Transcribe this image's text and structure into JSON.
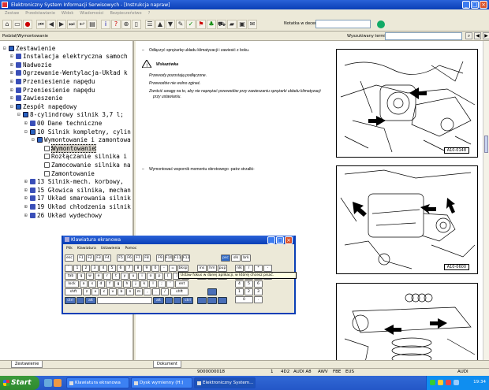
{
  "window": {
    "title": "Elektroniczny System Informacji Serwisowych - [Instrukcja napraw]"
  },
  "menu": [
    "Zestaw",
    "Przedstawianie",
    "Widok",
    "Wiadomości",
    "Bezpieczeństwo",
    "?"
  ],
  "toolbar": {
    "notes_label": "Notatka w decenie:"
  },
  "subbar": {
    "left_label": "Podział/Wymontowanie",
    "search_label": "Wyszukiwany termin"
  },
  "tree": {
    "items": [
      {
        "label": "Zestawienie",
        "level": 0,
        "exp": "⊟",
        "icon": "book"
      },
      {
        "label": "Instalacja elektryczna samoch",
        "level": 1,
        "exp": "⊞",
        "icon": "blue"
      },
      {
        "label": "Nadwozie",
        "level": 1,
        "exp": "⊞",
        "icon": "blue"
      },
      {
        "label": "Ogrzewanie-Wentylacja-Układ k",
        "level": 1,
        "exp": "⊞",
        "icon": "blue"
      },
      {
        "label": "Przeniesienie napędu",
        "level": 1,
        "exp": "⊞",
        "icon": "blue"
      },
      {
        "label": "Przeniesienie napędu",
        "level": 1,
        "exp": "⊞",
        "icon": "blue"
      },
      {
        "label": "Zawieszenie",
        "level": 1,
        "exp": "⊞",
        "icon": "blue"
      },
      {
        "label": "Zespół napędowy",
        "level": 1,
        "exp": "⊟",
        "icon": "book"
      },
      {
        "label": "8-cylindrowy silnik 3,7 l;",
        "level": 2,
        "exp": "⊟",
        "icon": "book"
      },
      {
        "label": "00 Dane techniczne",
        "level": 3,
        "exp": "⊞",
        "icon": "blue"
      },
      {
        "label": "10 Silnik kompletny, cylin",
        "level": 3,
        "exp": "⊟",
        "icon": "book"
      },
      {
        "label": "Wymontowanie i zamontowa",
        "level": 4,
        "exp": "⊟",
        "icon": "book"
      },
      {
        "label": "Wymontowanie",
        "level": 5,
        "exp": "",
        "icon": "doc",
        "selected": true
      },
      {
        "label": "Rozłączanie silnika i",
        "level": 5,
        "exp": "",
        "icon": "doc"
      },
      {
        "label": "Zamocowanie silnika na",
        "level": 5,
        "exp": "",
        "icon": "doc"
      },
      {
        "label": "Zamontowanie",
        "level": 5,
        "exp": "",
        "icon": "doc"
      },
      {
        "label": "13 Silnik-mech. korbowy,",
        "level": 3,
        "exp": "⊞",
        "icon": "blue"
      },
      {
        "label": "15 Głowica silnika, mechan",
        "level": 3,
        "exp": "⊞",
        "icon": "blue"
      },
      {
        "label": "17 Układ smarowania silnik",
        "level": 3,
        "exp": "⊞",
        "icon": "blue"
      },
      {
        "label": "19 Układ chłodzenia silnik",
        "level": 3,
        "exp": "⊞",
        "icon": "blue"
      },
      {
        "label": "26 Układ wydechowy",
        "level": 3,
        "exp": "⊞",
        "icon": "blue"
      }
    ],
    "tab_label": "Zestawienie"
  },
  "document": {
    "step1": "Odłączyć sprężarkę układu klimatyzacji i zawiesić z boku.",
    "note_title": "Wskazówka",
    "note_lines": [
      "Przewody pozostają podłączone.",
      "Przewodów nie wolno zginać.",
      "Zwrócić uwagę na to, aby nie naprężać przewodów przy zawieszaniu sprężarki układu klimatyzacji",
      "przy ustawianiu."
    ],
    "step2": "Wymontować wspornik momentu obrotowego -patrz strzałki-",
    "fig1_label": "A10-0148",
    "fig2_label": "A10-0600",
    "tab_label": "Dokument"
  },
  "statusbar": {
    "code": "9000000018",
    "num": "1",
    "model_code": "4D2",
    "brand": "AUDI A8",
    "drive": "AWV",
    "engine": "FBE",
    "market": "EUS",
    "right": "AUDI"
  },
  "osk": {
    "title": "Klawiatura ekranowa",
    "menu": [
      "Plik",
      "Klawiatura",
      "Ustawienia",
      "Pomoc"
    ],
    "tooltip": "Ustaw fokus w danej aplikacji, w której chcesz pisać.",
    "row_f": [
      "esc",
      "F1",
      "F2",
      "F3",
      "F4",
      "F5",
      "F6",
      "F7",
      "F8",
      "F9",
      "F10",
      "F11",
      "F12",
      "psc",
      "slk",
      "brk"
    ],
    "row_num": [
      "`",
      "1",
      "2",
      "3",
      "4",
      "5",
      "6",
      "7",
      "8",
      "9",
      "0",
      "-",
      "=",
      "bksp"
    ],
    "row_q": [
      "tab",
      "q",
      "w",
      "e",
      "r",
      "t",
      "y",
      "u",
      "i",
      "o",
      "p",
      "[",
      "]",
      "\\"
    ],
    "row_a": [
      "lock",
      "a",
      "s",
      "d",
      "f",
      "g",
      "h",
      "j",
      "k",
      "l",
      ";",
      "'",
      "ent"
    ],
    "row_z": [
      "shft",
      "z",
      "x",
      "c",
      "v",
      "b",
      "n",
      "m",
      ",",
      ".",
      "/",
      "shft"
    ],
    "row_b": [
      "ctrl",
      "alt",
      "alt",
      "ctrl"
    ],
    "side_keys": [
      "ins",
      "hm",
      "pup",
      "del",
      "end",
      "pdn"
    ],
    "num_keys": [
      "nlk",
      "/",
      "*",
      "-",
      "7",
      "8",
      "9",
      "+",
      "4",
      "5",
      "6",
      "1",
      "2",
      "3",
      "0",
      "."
    ]
  },
  "taskbar": {
    "start": "Start",
    "tasks": [
      "Klawiatura ekranowa",
      "Dysk wymienny (H:)",
      "Elektroniczny System..."
    ],
    "clock": "19:34"
  }
}
